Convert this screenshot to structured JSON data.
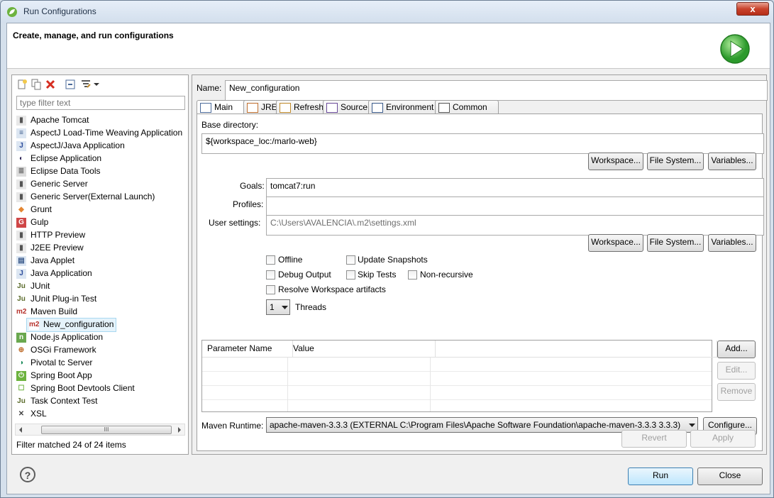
{
  "window": {
    "title": "Run Configurations",
    "close_symbol": "x"
  },
  "header": {
    "title": "Create, manage, and run configurations"
  },
  "left": {
    "filter_placeholder": "type filter text",
    "items": [
      {
        "label": "Apache Tomcat",
        "icon": "tomcat-icon"
      },
      {
        "label": "AspectJ Load-Time Weaving Application",
        "icon": "ltw-icon"
      },
      {
        "label": "AspectJ/Java Application",
        "icon": "aj-icon"
      },
      {
        "label": "Eclipse Application",
        "icon": "eclipse-icon"
      },
      {
        "label": "Eclipse Data Tools",
        "icon": "database-icon"
      },
      {
        "label": "Generic Server",
        "icon": "server-icon"
      },
      {
        "label": "Generic Server(External Launch)",
        "icon": "server-icon"
      },
      {
        "label": "Grunt",
        "icon": "grunt-icon"
      },
      {
        "label": "Gulp",
        "icon": "gulp-icon"
      },
      {
        "label": "HTTP Preview",
        "icon": "server-icon"
      },
      {
        "label": "J2EE Preview",
        "icon": "server-icon"
      },
      {
        "label": "Java Applet",
        "icon": "applet-icon"
      },
      {
        "label": "Java Application",
        "icon": "java-app-icon"
      },
      {
        "label": "JUnit",
        "icon": "junit-icon"
      },
      {
        "label": "JUnit Plug-in Test",
        "icon": "junit-plugin-icon"
      },
      {
        "label": "Maven Build",
        "icon": "maven-icon"
      },
      {
        "label": "New_configuration",
        "icon": "maven-icon"
      },
      {
        "label": "Node.js Application",
        "icon": "nodejs-icon"
      },
      {
        "label": "OSGi Framework",
        "icon": "osgi-icon"
      },
      {
        "label": "Pivotal tc Server",
        "icon": "pivotal-icon"
      },
      {
        "label": "Spring Boot App",
        "icon": "spring-boot-icon"
      },
      {
        "label": "Spring Boot Devtools Client",
        "icon": "spring-devtools-icon"
      },
      {
        "label": "Task Context Test",
        "icon": "task-context-icon"
      },
      {
        "label": "XSL",
        "icon": "xsl-icon"
      }
    ],
    "scroll_grip": "III",
    "status": "Filter matched 24 of 24 items"
  },
  "main": {
    "name_label": "Name:",
    "name_value": "New_configuration",
    "tabs": [
      {
        "label": "Main",
        "icon": "main-tab-icon"
      },
      {
        "label": "JRE",
        "icon": "jre-icon"
      },
      {
        "label": "Refresh",
        "icon": "refresh-icon"
      },
      {
        "label": "Source",
        "icon": "source-icon"
      },
      {
        "label": "Environment",
        "icon": "environment-icon"
      },
      {
        "label": "Common",
        "icon": "common-icon"
      }
    ],
    "base_dir_label": "Base directory:",
    "base_dir_value": "${workspace_loc:/marlo-web}",
    "workspace_btn": "Workspace...",
    "filesystem_btn": "File System...",
    "variables_btn": "Variables...",
    "goals_label": "Goals:",
    "goals_value": "tomcat7:run",
    "profiles_label": "Profiles:",
    "profiles_value": "",
    "user_settings_label": "User settings:",
    "user_settings_value": "C:\\Users\\AVALENCIA\\.m2\\settings.xml",
    "options": {
      "offline": "Offline",
      "update_snapshots": "Update Snapshots",
      "debug_output": "Debug Output",
      "skip_tests": "Skip Tests",
      "non_recursive": "Non-recursive",
      "resolve_workspace": "Resolve Workspace artifacts"
    },
    "threads_value": "1",
    "threads_label": "Threads",
    "param_headers": [
      "Parameter Name",
      "Value"
    ],
    "add_btn": "Add...",
    "edit_btn": "Edit...",
    "remove_btn": "Remove",
    "runtime_label": "Maven Runtime:",
    "runtime_value": "apache-maven-3.3.3 (EXTERNAL C:\\Program Files\\Apache Software Foundation\\apache-maven-3.3.3 3.3.3)",
    "configure_btn": "Configure...",
    "revert_btn": "Revert",
    "apply_btn": "Apply"
  },
  "footer": {
    "run_btn": "Run",
    "close_btn": "Close",
    "help_symbol": "?"
  },
  "colors": {
    "accent": "#3c7fb1",
    "selection": "#e5f3fb",
    "run_green": "#34a33a"
  }
}
